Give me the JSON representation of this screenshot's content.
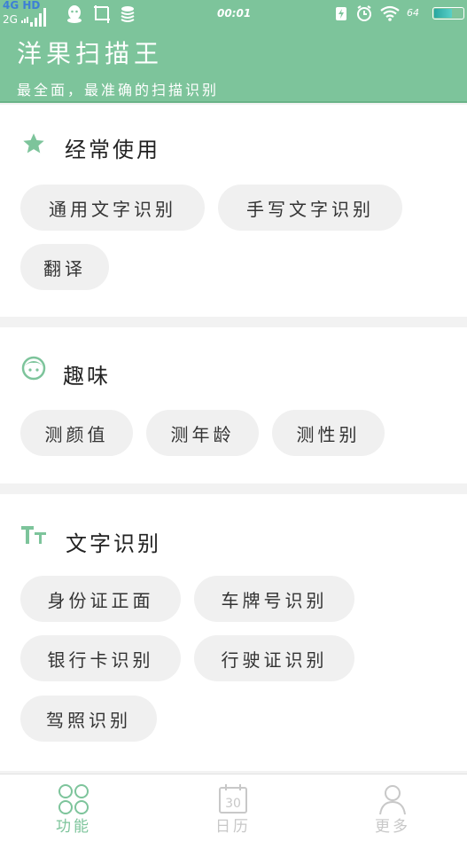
{
  "status_bar": {
    "network_top": "4G HD",
    "network_bottom": "2G",
    "time": "00:01",
    "battery_text": "64",
    "battery_level_percent": 64
  },
  "header": {
    "title": "洋果扫描王",
    "subtitle": "最全面，最准确的扫描识别"
  },
  "sections": [
    {
      "title": "经常使用",
      "icon": "star-icon",
      "items": [
        "通用文字识别",
        "手写文字识别",
        "翻译"
      ]
    },
    {
      "title": "趣味",
      "icon": "face-icon",
      "items": [
        "测颜值",
        "测年龄",
        "测性别"
      ]
    },
    {
      "title": "文字识别",
      "icon": "text-size-icon",
      "items": [
        "身份证正面",
        "车牌号识别",
        "银行卡识别",
        "行驶证识别",
        "驾照识别"
      ]
    }
  ],
  "bottom_nav": [
    {
      "label": "功能",
      "icon": "grid-icon",
      "active": true
    },
    {
      "label": "日历",
      "icon": "calendar-icon",
      "calendar_day": "30",
      "active": false
    },
    {
      "label": "更多",
      "icon": "person-icon",
      "active": false
    }
  ],
  "colors": {
    "brand": "#7dc49b",
    "chip_bg": "#f0f0f0",
    "nav_inactive": "#c8c8c8"
  }
}
